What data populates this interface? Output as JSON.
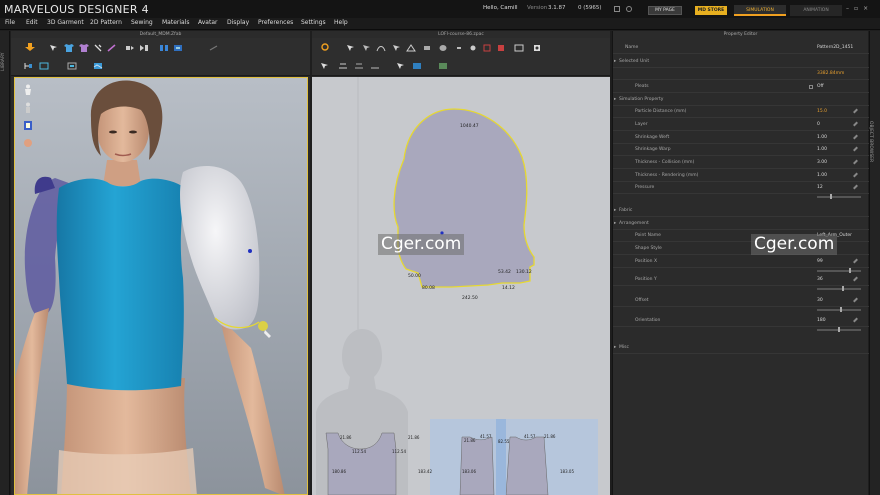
{
  "app": {
    "title": "MARVELOUS DESIGNER 4"
  },
  "topbar": {
    "greeting": "Hello, Camill",
    "version_label": "Version",
    "version_value": "3.1.87",
    "count_value": "0 (5965)",
    "my_page": "MY PAGE",
    "md_store": "MD STORE",
    "mode_simulation": "SIMULATION",
    "mode_animation": "ANIMATION"
  },
  "menu": [
    "File",
    "Edit",
    "3D Garment",
    "2D Pattern",
    "Sewing",
    "Materials",
    "Avatar",
    "Display",
    "Preferences",
    "Settings",
    "Help"
  ],
  "side_tabs": {
    "library": "LIBRARY",
    "object_browser": "OBJECT BROWSER"
  },
  "panels": {
    "window3d_title": "Default_MDM.Zfab",
    "window2d_title": "LOFI-course-86.zpac",
    "property_title": "Property Editor"
  },
  "pattern2d": {
    "top_labels": [
      {
        "text": "1040.47"
      },
      {
        "text": "130.12"
      },
      {
        "text": "50.00"
      },
      {
        "text": "80.08"
      },
      {
        "text": "53.42"
      },
      {
        "text": "14.12"
      },
      {
        "text": "242.50"
      }
    ],
    "bottom_labels": [
      "21.86",
      "21.86",
      "112.54",
      "112.54",
      "180.86",
      "183.42",
      "21.86",
      "41.57",
      "21.86",
      "41.57",
      "82.55",
      "183.06",
      "183.05"
    ]
  },
  "property_editor": {
    "rows": [
      {
        "label": "Name",
        "value": "Pattern2D_1451",
        "kind": "text",
        "indent": 0
      },
      {
        "label": "Selected Unit",
        "value": "",
        "kind": "section",
        "indent": 0
      },
      {
        "label": "",
        "value": "3382.84mm",
        "kind": "orange",
        "indent": 0
      },
      {
        "label": "Pleats",
        "value": "Off",
        "kind": "check",
        "indent": 1
      },
      {
        "label": "Simulation Property",
        "value": "",
        "kind": "section",
        "indent": 0
      },
      {
        "label": "Particle Distance (mm)",
        "value": "15.0",
        "kind": "orange-edit",
        "indent": 1
      },
      {
        "label": "Layer",
        "value": "0",
        "kind": "edit",
        "indent": 1
      },
      {
        "label": "Shrinkage Weft",
        "value": "1.00",
        "kind": "edit",
        "indent": 1
      },
      {
        "label": "Shrinkage Warp",
        "value": "1.00",
        "kind": "edit",
        "indent": 1
      },
      {
        "label": "Thickness - Collision (mm)",
        "value": "3.00",
        "kind": "edit",
        "indent": 1
      },
      {
        "label": "Thickness - Rendering (mm)",
        "value": "1.00",
        "kind": "edit",
        "indent": 1
      },
      {
        "label": "Pressure",
        "value": "12",
        "kind": "slider-edit",
        "slider": 0.3,
        "indent": 1
      },
      {
        "label": "Fabric",
        "value": "",
        "kind": "section",
        "indent": 0
      },
      {
        "label": "Arrangement",
        "value": "",
        "kind": "section",
        "indent": 0
      },
      {
        "label": "Point Name",
        "value": "Left_Arm_Outer",
        "kind": "text",
        "indent": 1
      },
      {
        "label": "Shape Style",
        "value": "",
        "kind": "text",
        "indent": 1
      },
      {
        "label": "Position X",
        "value": "99",
        "kind": "slider-edit",
        "slider": 0.75,
        "indent": 1
      },
      {
        "label": "Position Y",
        "value": "36",
        "kind": "slider-edit",
        "slider": 0.6,
        "indent": 1
      },
      {
        "label": "Offset",
        "value": "30",
        "kind": "slider-edit",
        "slider": 0.55,
        "indent": 1
      },
      {
        "label": "Orientation",
        "value": "180",
        "kind": "slider-edit",
        "slider": 0.5,
        "indent": 1
      },
      {
        "label": "Misc",
        "value": "",
        "kind": "section",
        "indent": 0
      }
    ]
  },
  "watermarks": [
    "Cger.com",
    "Cger.com"
  ],
  "colors": {
    "accent": "#e8b020",
    "viewport_border": "#e0c040",
    "pattern_fill": "#a9a8bd",
    "pattern_outline": "#e6d832",
    "shirt": "#1f98c8"
  }
}
